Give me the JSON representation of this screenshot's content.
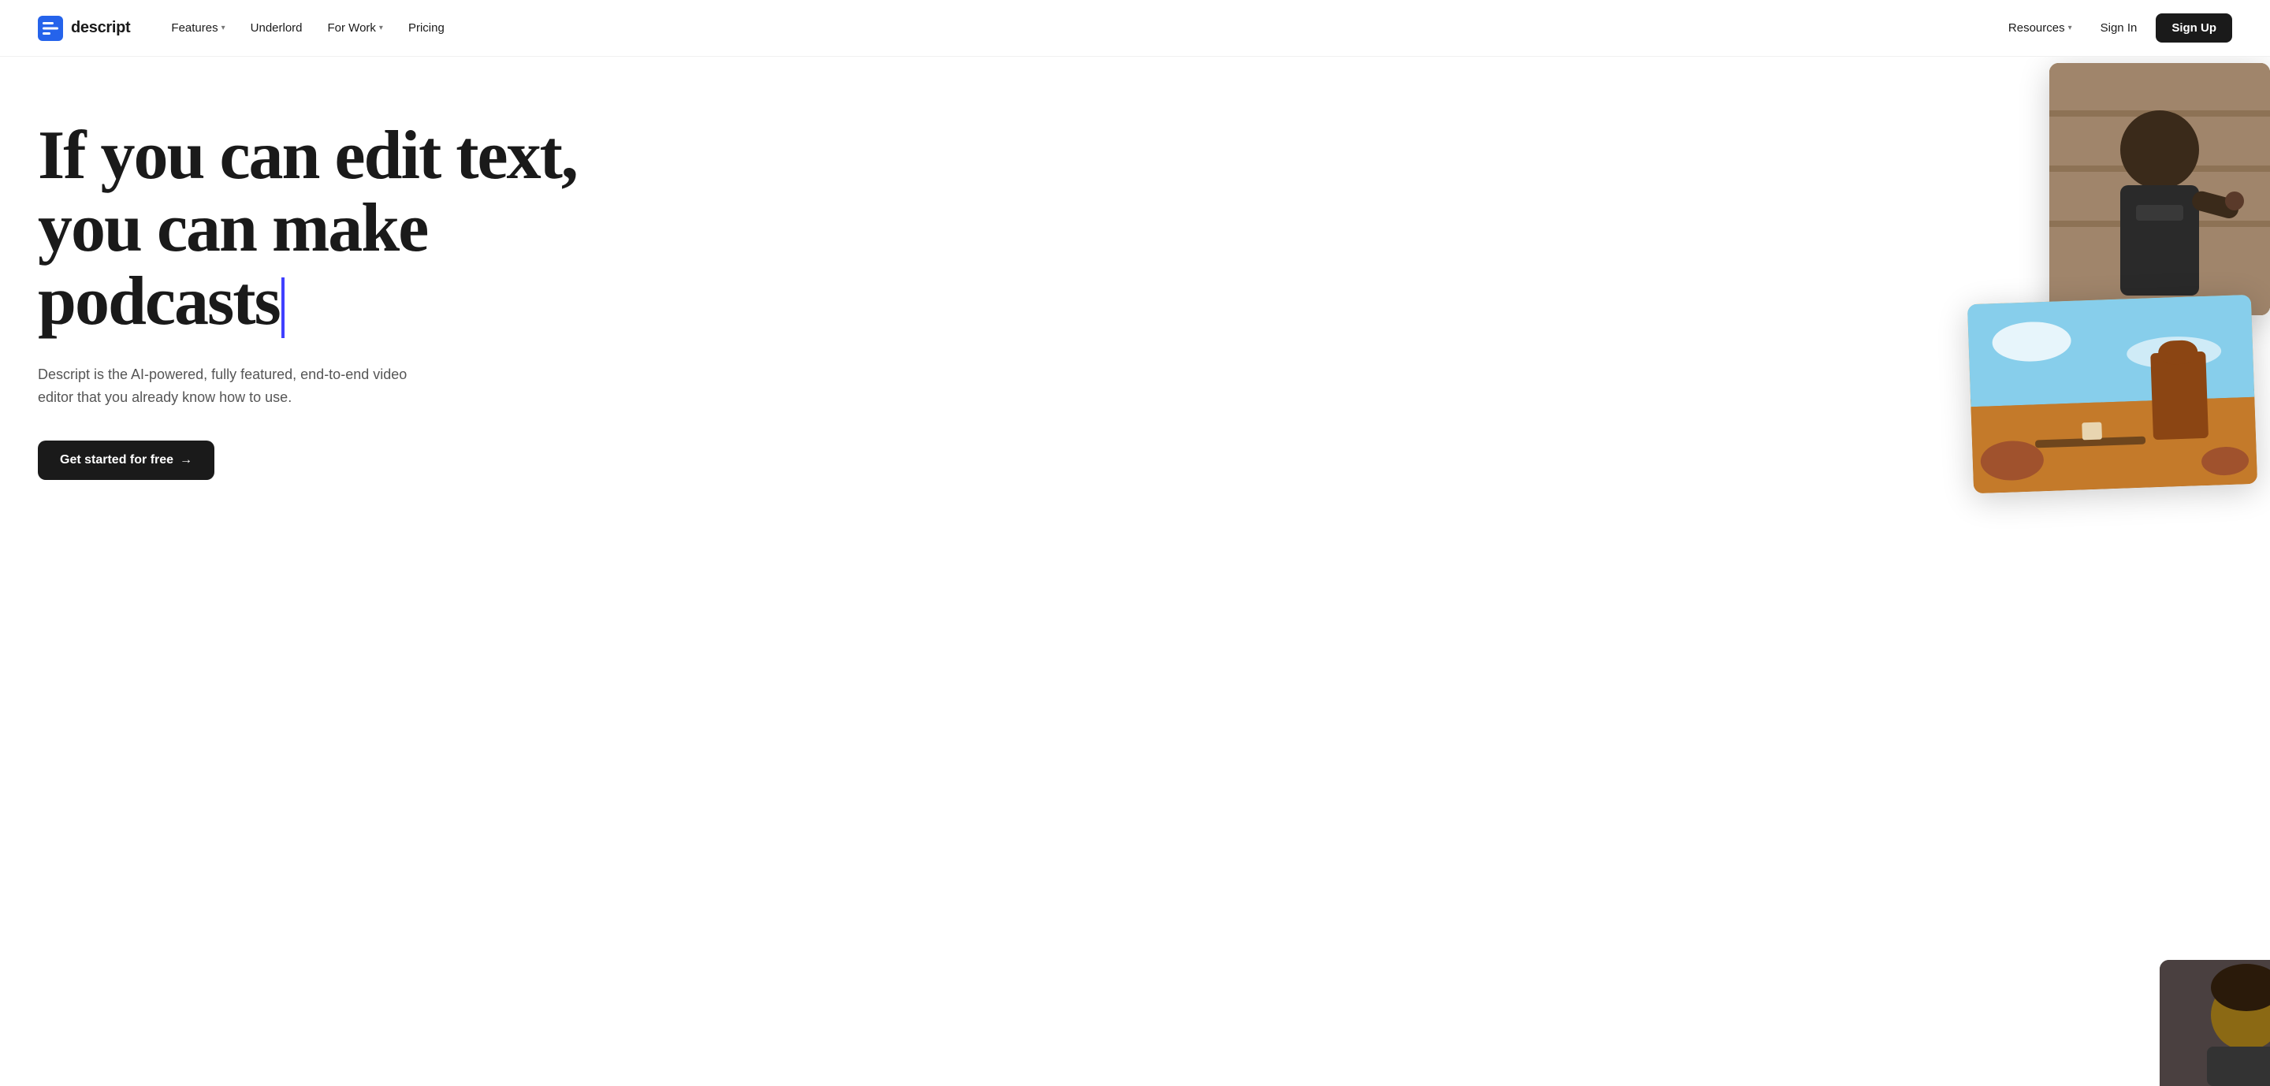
{
  "nav": {
    "logo_text": "descript",
    "links": [
      {
        "label": "Features",
        "has_dropdown": true
      },
      {
        "label": "Underlord",
        "has_dropdown": false
      },
      {
        "label": "For Work",
        "has_dropdown": true
      },
      {
        "label": "Pricing",
        "has_dropdown": false
      }
    ],
    "right_links": [
      {
        "label": "Resources",
        "has_dropdown": true
      },
      {
        "label": "Sign In",
        "has_dropdown": false
      }
    ],
    "signup_label": "Sign Up"
  },
  "hero": {
    "headline_line1": "If you can edit text,",
    "headline_line2": "you can make podcasts",
    "subtitle": "Descript is the AI-powered, fully featured, end-to-end video editor that you already know how to use.",
    "cta_label": "Get started for free",
    "cta_arrow": "→",
    "cursor_color": "#4040ff"
  }
}
